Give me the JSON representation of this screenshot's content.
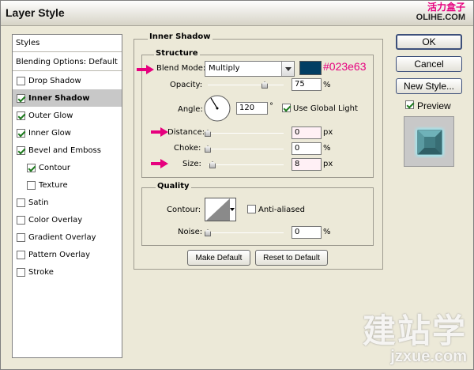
{
  "window": {
    "title": "Layer Style"
  },
  "watermark_top": {
    "cn": "活力盒子",
    "site": "OLIHE.COM"
  },
  "watermark_bottom": {
    "cn": "建站学",
    "url": "jzxue.com"
  },
  "styles_list": {
    "header": "Styles",
    "blending_options": "Blending Options: Default",
    "items": [
      {
        "label": "Drop Shadow",
        "checked": false,
        "selected": false,
        "indent": false
      },
      {
        "label": "Inner Shadow",
        "checked": true,
        "selected": true,
        "indent": false
      },
      {
        "label": "Outer Glow",
        "checked": true,
        "selected": false,
        "indent": false
      },
      {
        "label": "Inner Glow",
        "checked": true,
        "selected": false,
        "indent": false
      },
      {
        "label": "Bevel and Emboss",
        "checked": true,
        "selected": false,
        "indent": false
      },
      {
        "label": "Contour",
        "checked": true,
        "selected": false,
        "indent": true
      },
      {
        "label": "Texture",
        "checked": false,
        "selected": false,
        "indent": true
      },
      {
        "label": "Satin",
        "checked": false,
        "selected": false,
        "indent": false
      },
      {
        "label": "Color Overlay",
        "checked": false,
        "selected": false,
        "indent": false
      },
      {
        "label": "Gradient Overlay",
        "checked": false,
        "selected": false,
        "indent": false
      },
      {
        "label": "Pattern Overlay",
        "checked": false,
        "selected": false,
        "indent": false
      },
      {
        "label": "Stroke",
        "checked": false,
        "selected": false,
        "indent": false
      }
    ]
  },
  "inner_shadow": {
    "title": "Inner Shadow",
    "structure_title": "Structure",
    "blend_mode_label": "Blend Mode:",
    "blend_mode_value": "Multiply",
    "color_hex_label": "#023e63",
    "color": "#023e63",
    "opacity_label": "Opacity:",
    "opacity_value": "75",
    "opacity_unit": "%",
    "opacity_level": 0.75,
    "angle_label": "Angle:",
    "angle_value": "120",
    "angle_unit": "°",
    "use_global_light_label": "Use Global Light",
    "use_global_light": true,
    "distance_label": "Distance:",
    "distance_value": "0",
    "distance_unit": "px",
    "choke_label": "Choke:",
    "choke_value": "0",
    "choke_unit": "%",
    "size_label": "Size:",
    "size_value": "8",
    "size_unit": "px",
    "quality_title": "Quality",
    "contour_label": "Contour:",
    "anti_aliased_label": "Anti-aliased",
    "anti_aliased": false,
    "noise_label": "Noise:",
    "noise_value": "0",
    "noise_unit": "%",
    "make_default_label": "Make Default",
    "reset_default_label": "Reset to Default"
  },
  "buttons": {
    "ok": "OK",
    "cancel": "Cancel",
    "new_style": "New Style...",
    "preview_label": "Preview",
    "preview_checked": true
  },
  "colors": {
    "accent_pink": "#e6007e",
    "swatch": "#023e63",
    "preview_teal": "#4a8c93"
  }
}
